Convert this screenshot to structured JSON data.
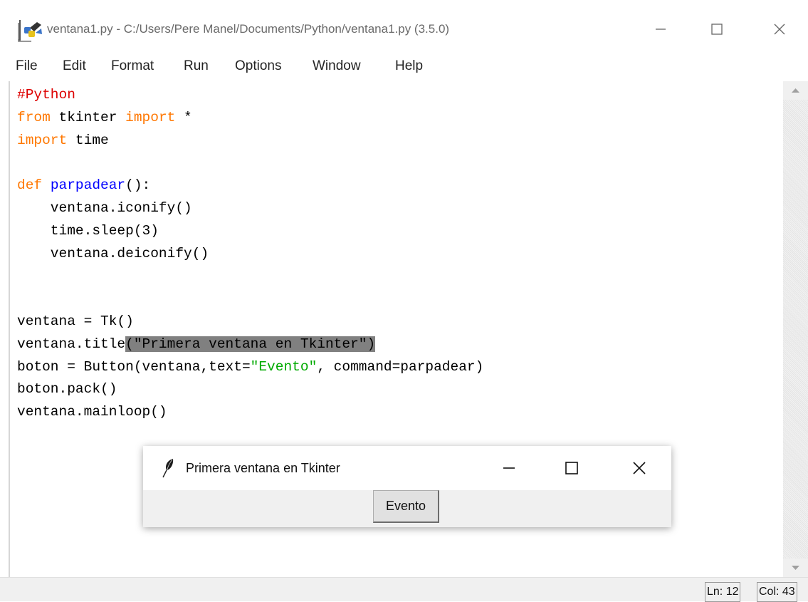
{
  "window": {
    "title": "ventana1.py - C:/Users/Pere Manel/Documents/Python/ventana1.py (3.5.0)",
    "controls": [
      "minimize-icon",
      "maximize-icon",
      "close-icon"
    ]
  },
  "menu": {
    "items": [
      {
        "label": "File"
      },
      {
        "label": "Edit"
      },
      {
        "label": "Format"
      },
      {
        "label": "Run"
      },
      {
        "label": "Options"
      },
      {
        "label": "Window"
      },
      {
        "label": "Help"
      }
    ]
  },
  "editor": {
    "lines": [
      "#Python",
      "from tkinter import *",
      "import time",
      "",
      "def parpadear():",
      "    ventana.iconify()",
      "    time.sleep(3)",
      "    ventana.deiconify()",
      "",
      "",
      "ventana = Tk()",
      "ventana.title(\"Primera ventana en Tkinter\")",
      "boton = Button(ventana,text=\"Evento\", command=parpadear)",
      "boton.pack()",
      "ventana.mainloop()"
    ],
    "selection_text": "(\"Primera ventana en Tkinter\")",
    "colors": {
      "keyword": "#ff7700",
      "comment": "#dd0000",
      "definition": "#0000ff",
      "string": "#00aa00",
      "selection": "#808080"
    }
  },
  "status": {
    "line": "Ln: 12",
    "col": "Col: 43"
  },
  "tk_window": {
    "title": "Primera ventana en Tkinter",
    "button_label": "Evento",
    "icon": "feather-icon"
  }
}
